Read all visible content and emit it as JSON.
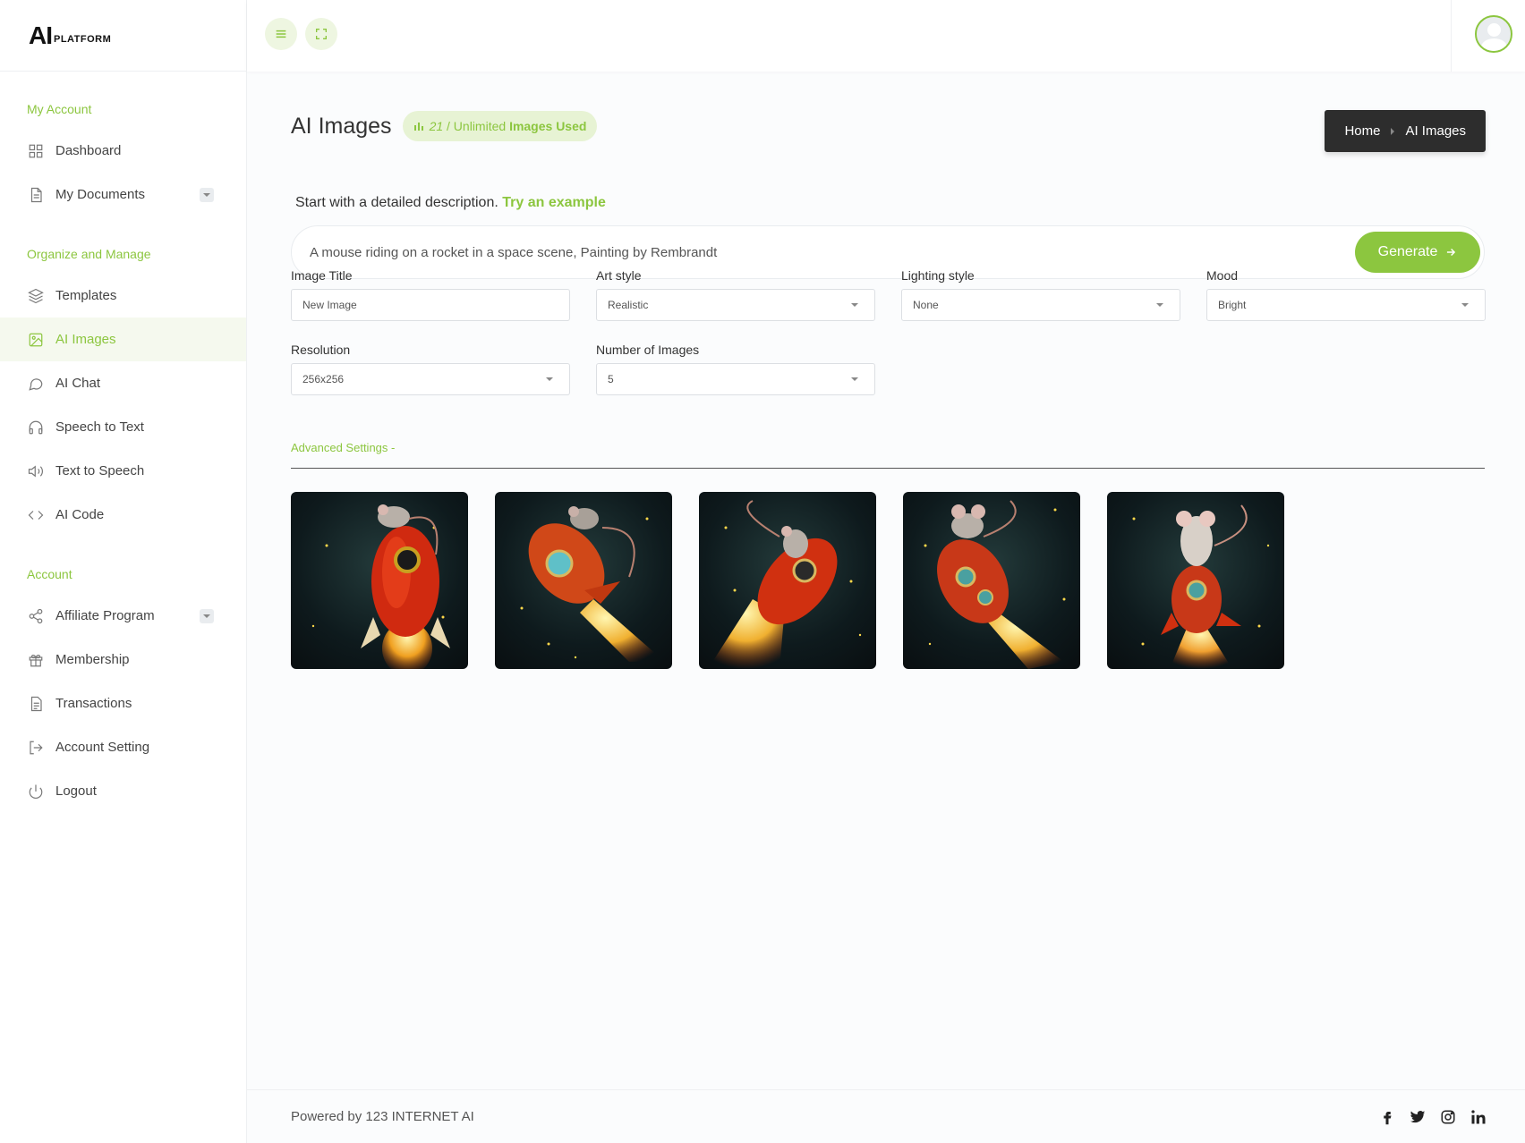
{
  "app": {
    "logo_ai": "AI",
    "logo_platform": "PLATFORM",
    "accent": "#8cc63f"
  },
  "sidebar": {
    "sections": [
      {
        "title": "My Account"
      },
      {
        "title": "Organize and Manage"
      },
      {
        "title": "Account"
      }
    ],
    "items": {
      "dashboard": {
        "label": "Dashboard",
        "icon": "grid-icon"
      },
      "documents": {
        "label": "My Documents",
        "icon": "document-icon"
      },
      "templates": {
        "label": "Templates",
        "icon": "layers-icon"
      },
      "ai_images": {
        "label": "AI Images",
        "icon": "image-icon"
      },
      "ai_chat": {
        "label": "AI Chat",
        "icon": "chat-icon"
      },
      "speech_to_text": {
        "label": "Speech to Text",
        "icon": "headphones-icon"
      },
      "text_to_speech": {
        "label": "Text to Speech",
        "icon": "speaker-icon"
      },
      "ai_code": {
        "label": "AI Code",
        "icon": "code-icon"
      },
      "affiliate": {
        "label": "Affiliate Program",
        "icon": "share-icon"
      },
      "membership": {
        "label": "Membership",
        "icon": "gift-icon"
      },
      "transactions": {
        "label": "Transactions",
        "icon": "receipt-icon"
      },
      "account_setting": {
        "label": "Account Setting",
        "icon": "logout-arrow-icon"
      },
      "logout": {
        "label": "Logout",
        "icon": "power-icon"
      }
    }
  },
  "page": {
    "title": "AI Images",
    "usage_count": "21",
    "usage_text": " / Unlimited ",
    "usage_strong": "Images Used",
    "breadcrumb": {
      "home": "Home",
      "current": "AI Images"
    },
    "intro_text": "Start with a detailed description. ",
    "intro_link": "Try an example",
    "prompt_value": "A mouse riding on a rocket in a space scene, Painting by Rembrandt",
    "generate_label": "Generate",
    "fields": {
      "image_title": {
        "label": "Image Title",
        "placeholder": "New Image"
      },
      "art_style": {
        "label": "Art style",
        "value": "Realistic"
      },
      "lighting": {
        "label": "Lighting style",
        "value": "None"
      },
      "mood": {
        "label": "Mood",
        "value": "Bright"
      },
      "resolution": {
        "label": "Resolution",
        "value": "256x256"
      },
      "num_images": {
        "label": "Number of Images",
        "value": "5"
      }
    },
    "advanced_label": "Advanced Settings -"
  },
  "footer": {
    "powered": "Powered by 123 INTERNET AI"
  }
}
